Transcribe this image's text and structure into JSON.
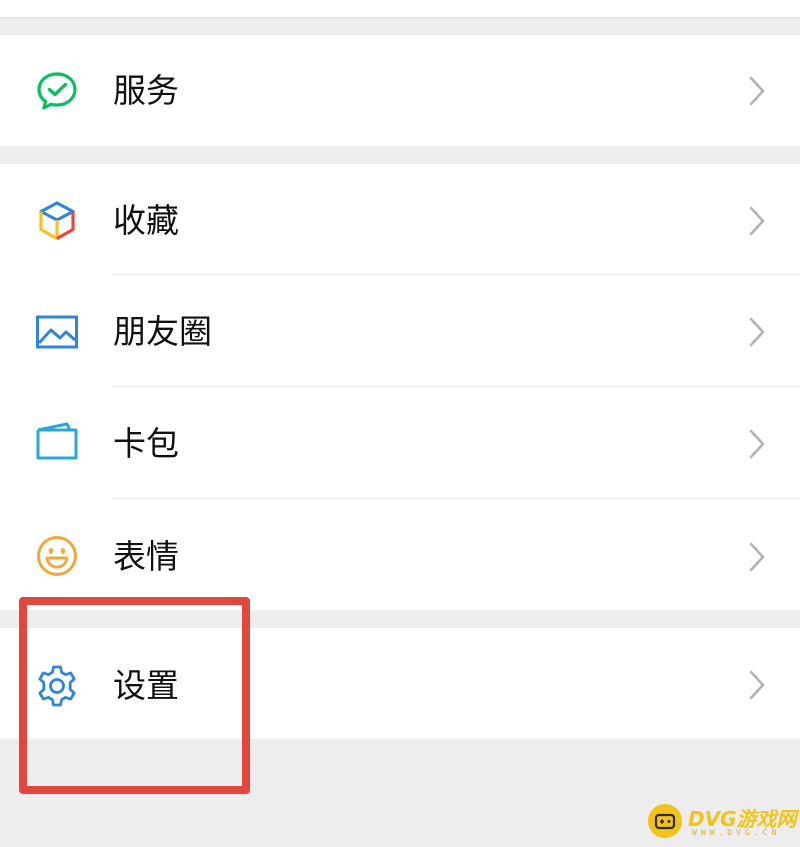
{
  "colors": {
    "background": "#ededed",
    "cell": "#ffffff",
    "text": "#111111",
    "chevron": "#b2b2b2",
    "highlight": "#e2473d",
    "watermark": "#f4c21a",
    "services_icon": "#07c160",
    "moments_icon": "#2f86d9",
    "cards_icon": "#2aa7d8",
    "stickers_icon": "#f0a93e",
    "settings_icon": "#2f86d9"
  },
  "menu": {
    "group1": [
      {
        "label": "服务",
        "icon": "chat-check-icon"
      }
    ],
    "group2": [
      {
        "label": "收藏",
        "icon": "cube-icon"
      },
      {
        "label": "朋友圈",
        "icon": "image-icon"
      },
      {
        "label": "卡包",
        "icon": "wallet-card-icon"
      },
      {
        "label": "表情",
        "icon": "smiley-icon"
      }
    ],
    "group3": [
      {
        "label": "设置",
        "icon": "gear-icon"
      }
    ]
  },
  "watermark": {
    "text": "DVG游戏网",
    "sub": "WWW.DVG.CN"
  }
}
